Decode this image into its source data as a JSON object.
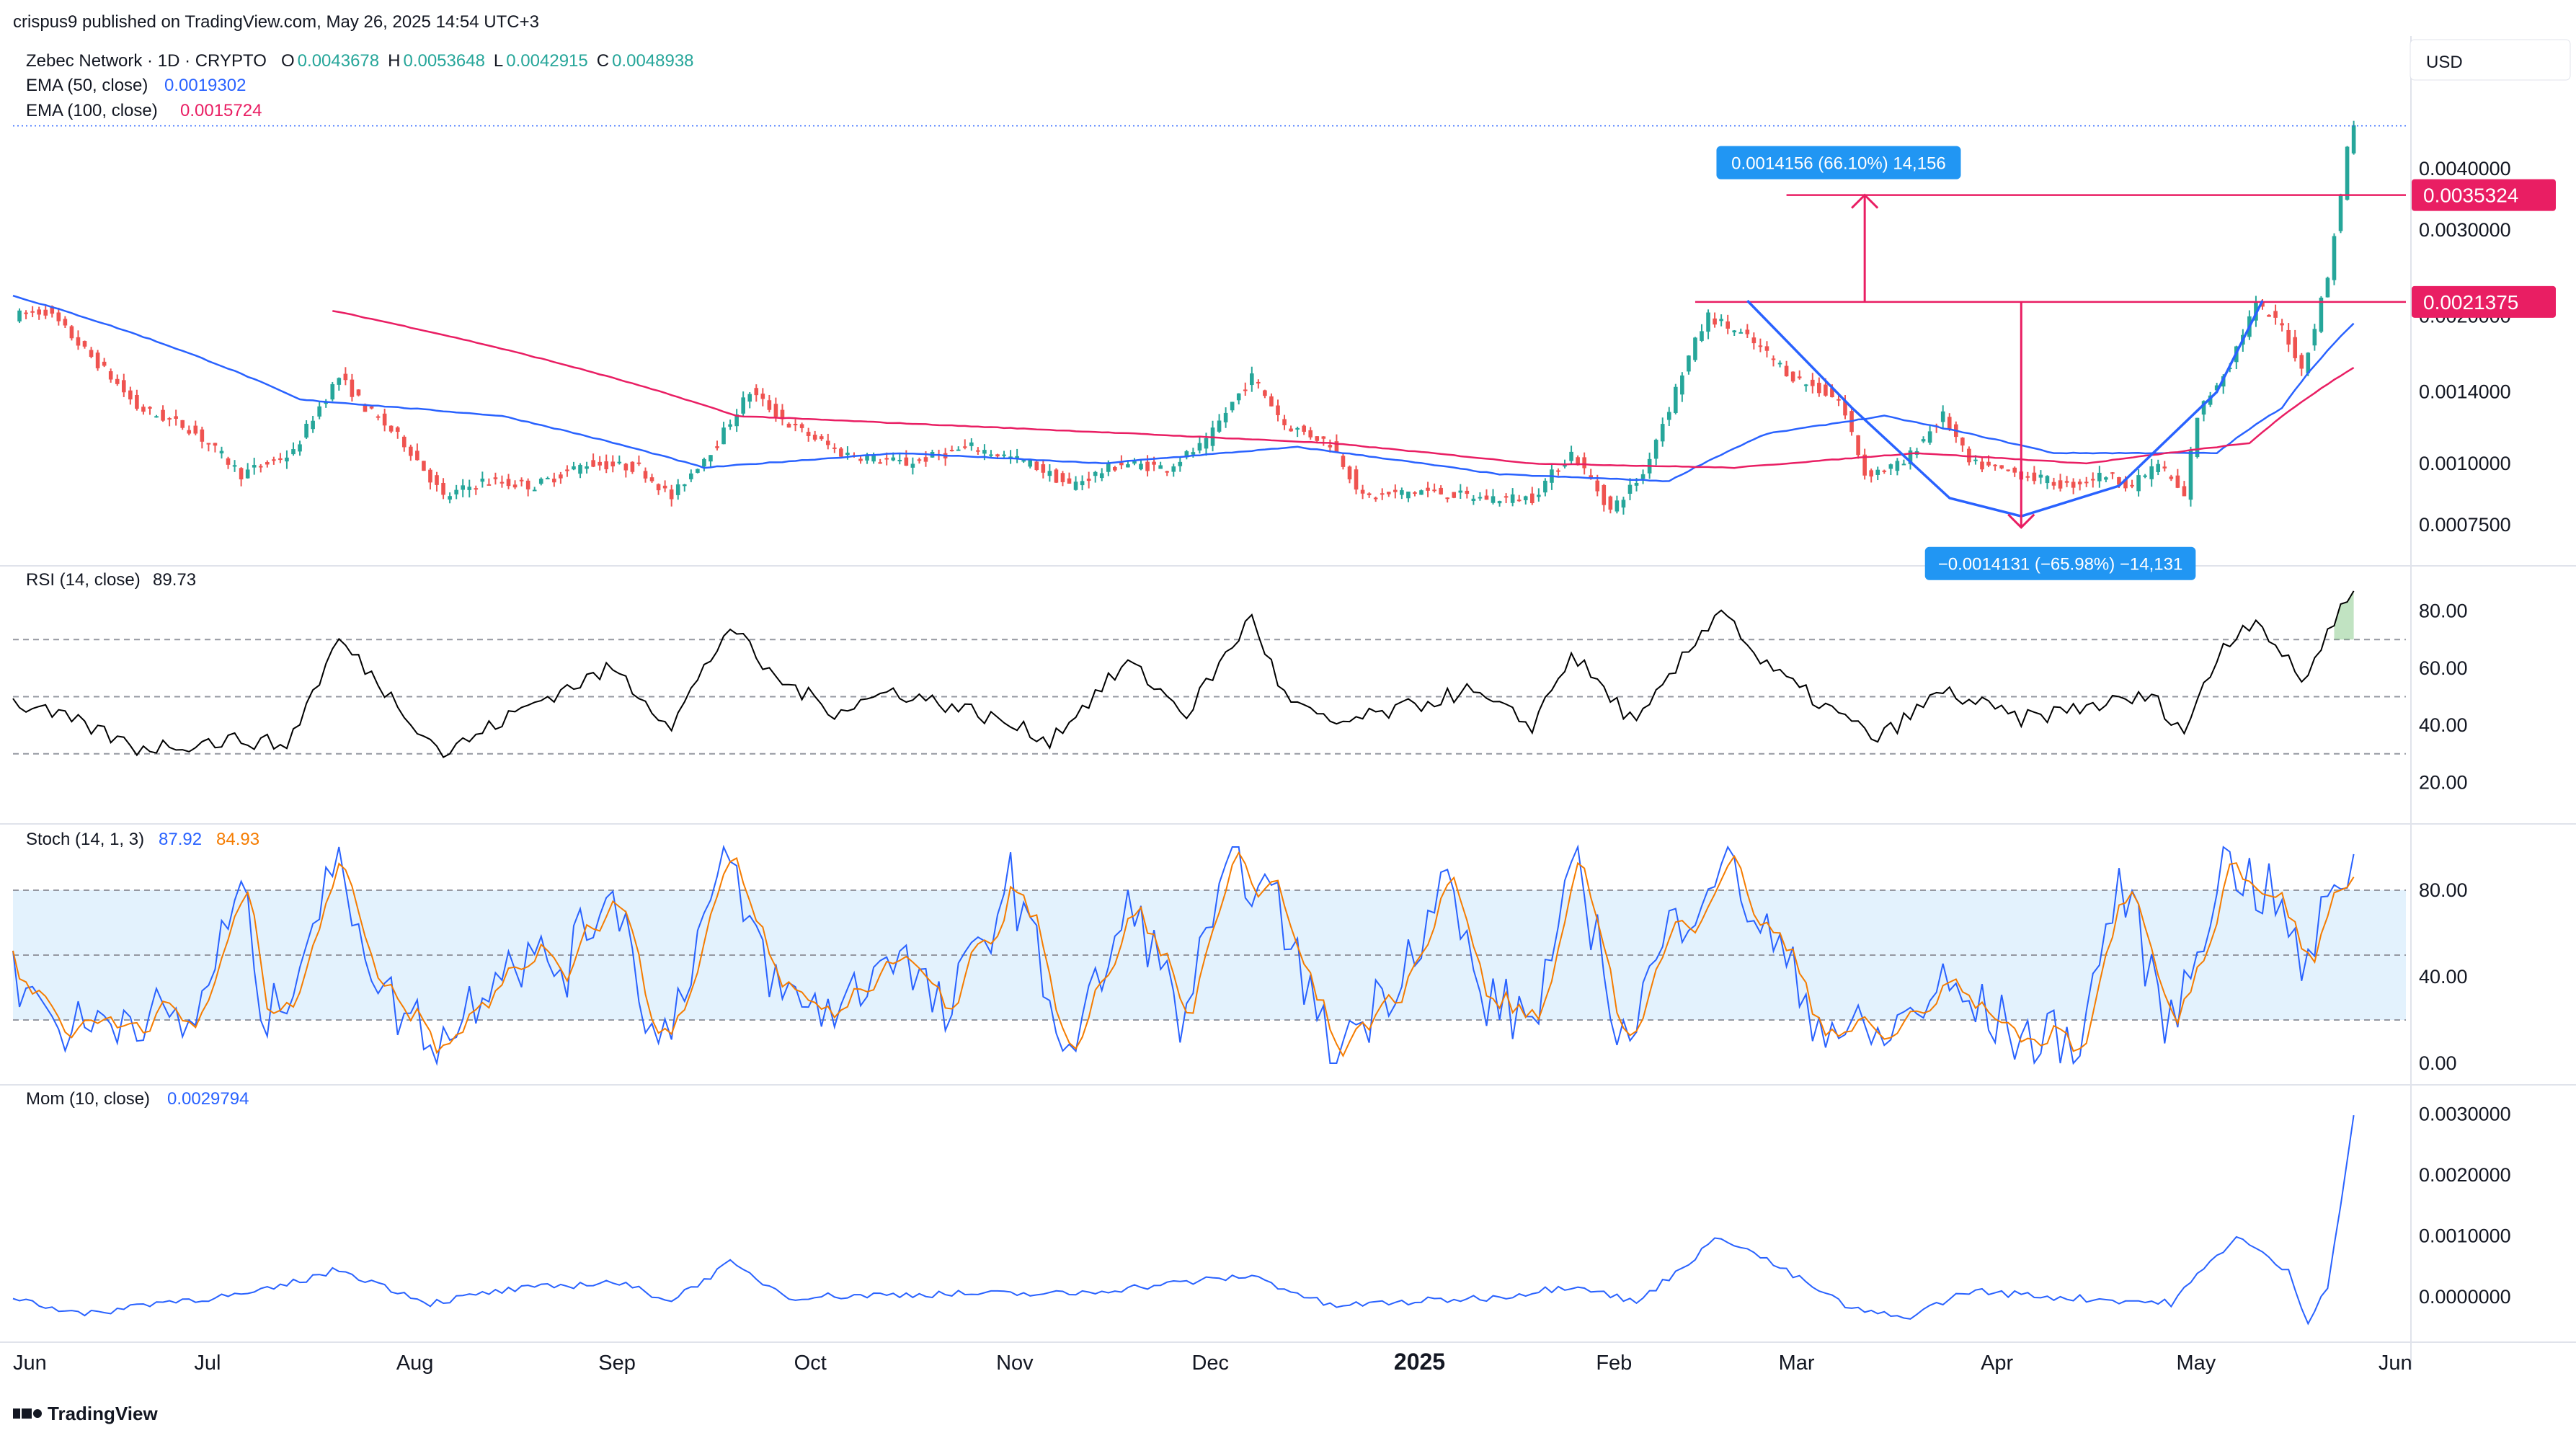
{
  "header": {
    "published": "crispus9 published on TradingView.com, May 26, 2025 14:54 UTC+3",
    "currency": "USD",
    "branding": "TradingView"
  },
  "symbol": {
    "name": "Zebec Network · 1D · CRYPTO",
    "ohlc": [
      {
        "label": "O",
        "value": "0.0043678"
      },
      {
        "label": "H",
        "value": "0.0053648"
      },
      {
        "label": "L",
        "value": "0.0042915"
      },
      {
        "label": "C",
        "value": "0.0048938"
      }
    ],
    "ema50": {
      "label": "EMA (50, close)",
      "value": "0.0019302"
    },
    "ema100": {
      "label": "EMA (100, close)",
      "value": "0.0015724"
    }
  },
  "price_axis": {
    "ticks": [
      "0.0040000",
      "0.0030000",
      "0.0014000",
      "0.0010000",
      "0.0007500"
    ],
    "tick_values": [
      0.004,
      0.003,
      0.0014,
      0.001,
      0.00075
    ],
    "marker_tick": "0.0020000",
    "marker_tick_value": 0.002,
    "levels": [
      {
        "label": "0.0035324",
        "value": 0.0035324
      },
      {
        "label": "0.0021375",
        "value": 0.0021375
      }
    ]
  },
  "measurements": [
    {
      "label": "0.0014156 (66.10%) 14,156",
      "color": "#2196f3"
    },
    {
      "label": "−0.0014131 (−65.98%) −14,131",
      "color": "#2196f3"
    }
  ],
  "rsi": {
    "label": "RSI (14, close)",
    "value": "89.73",
    "ticks": [
      "80.00",
      "60.00",
      "40.00",
      "20.00"
    ],
    "tick_values": [
      80,
      60,
      40,
      20
    ],
    "band_levels": [
      70,
      50,
      30
    ]
  },
  "stoch": {
    "label": "Stoch (14, 1, 3)",
    "k_value": "87.92",
    "d_value": "84.93",
    "ticks": [
      "80.00",
      "40.00",
      "0.00"
    ],
    "tick_values": [
      80,
      40,
      0
    ],
    "band_levels": [
      80,
      50,
      20
    ]
  },
  "mom": {
    "label": "Mom (10, close)",
    "value": "0.0029794",
    "ticks": [
      "0.0030000",
      "0.0020000",
      "0.0010000",
      "0.0000000"
    ],
    "tick_values": [
      0.003,
      0.002,
      0.001,
      0
    ]
  },
  "time_axis": {
    "labels": [
      "Jun",
      "Jul",
      "Aug",
      "Sep",
      "Oct",
      "Nov",
      "Dec",
      "2025",
      "Feb",
      "Mar",
      "Apr",
      "May",
      "Jun"
    ],
    "bold_label": "2025"
  },
  "colors": {
    "up": "#26a69a",
    "down": "#ef5350",
    "ema50": "#2962ff",
    "ema100": "#e91e63",
    "level": "#e91e63",
    "rsi": "#000000",
    "stoch_k": "#2962ff",
    "stoch_d": "#f57c00",
    "mom": "#2962ff",
    "band_fill": "#e3f2fd",
    "measure": "#2196f3"
  },
  "chart_data": {
    "type": "candlestick",
    "title": "Zebec Network · 1D · CRYPTO",
    "x_range": [
      "2024-06-01",
      "2025-06-03"
    ],
    "y_range": [
      0.00065,
      0.0055
    ],
    "y_scale": "log",
    "anchors": [
      [
        "2024-06-01",
        0.002
      ],
      [
        "2024-06-06",
        0.00205
      ],
      [
        "2024-06-12",
        0.0017
      ],
      [
        "2024-06-20",
        0.0013
      ],
      [
        "2024-06-28",
        0.00118
      ],
      [
        "2024-07-06",
        0.00095
      ],
      [
        "2024-07-14",
        0.00105
      ],
      [
        "2024-07-21",
        0.0015
      ],
      [
        "2024-07-25",
        0.0013
      ],
      [
        "2024-07-31",
        0.0011
      ],
      [
        "2024-08-06",
        0.00085
      ],
      [
        "2024-08-12",
        0.00092
      ],
      [
        "2024-08-20",
        0.0009
      ],
      [
        "2024-08-28",
        0.001
      ],
      [
        "2024-09-05",
        0.00098
      ],
      [
        "2024-09-10",
        0.00085
      ],
      [
        "2024-09-17",
        0.0011
      ],
      [
        "2024-09-22",
        0.0014
      ],
      [
        "2024-09-28",
        0.0012
      ],
      [
        "2024-10-06",
        0.00105
      ],
      [
        "2024-10-16",
        0.001
      ],
      [
        "2024-10-26",
        0.00108
      ],
      [
        "2024-11-04",
        0.001
      ],
      [
        "2024-11-10",
        0.0009
      ],
      [
        "2024-11-18",
        0.001
      ],
      [
        "2024-11-25",
        0.00098
      ],
      [
        "2024-12-01",
        0.0011
      ],
      [
        "2024-12-08",
        0.0015
      ],
      [
        "2024-12-13",
        0.0012
      ],
      [
        "2024-12-20",
        0.0011
      ],
      [
        "2024-12-25",
        0.00085
      ],
      [
        "2025-01-03",
        0.00088
      ],
      [
        "2025-01-12",
        0.00085
      ],
      [
        "2025-01-20",
        0.00085
      ],
      [
        "2025-01-26",
        0.00105
      ],
      [
        "2025-02-01",
        0.0008
      ],
      [
        "2025-02-06",
        0.00095
      ],
      [
        "2025-02-10",
        0.0013
      ],
      [
        "2025-02-16",
        0.002
      ],
      [
        "2025-02-22",
        0.0018
      ],
      [
        "2025-03-01",
        0.0015
      ],
      [
        "2025-03-08",
        0.00135
      ],
      [
        "2025-03-12",
        0.00095
      ],
      [
        "2025-03-18",
        0.001
      ],
      [
        "2025-03-24",
        0.00125
      ],
      [
        "2025-03-28",
        0.001
      ],
      [
        "2025-04-05",
        0.00095
      ],
      [
        "2025-04-12",
        0.0009
      ],
      [
        "2025-04-18",
        0.00095
      ],
      [
        "2025-04-22",
        0.0009
      ],
      [
        "2025-04-26",
        0.001
      ],
      [
        "2025-04-30",
        0.00085
      ],
      [
        "2025-05-02",
        0.00125
      ],
      [
        "2025-05-07",
        0.0016
      ],
      [
        "2025-05-11",
        0.0021
      ],
      [
        "2025-05-15",
        0.0019
      ],
      [
        "2025-05-18",
        0.00155
      ],
      [
        "2025-05-20",
        0.0019
      ],
      [
        "2025-05-22",
        0.0024
      ],
      [
        "2025-05-24",
        0.0035
      ],
      [
        "2025-05-25",
        0.0044
      ],
      [
        "2025-05-26",
        0.00489
      ]
    ],
    "ema50_path": [
      [
        "2024-06-01",
        0.0022
      ],
      [
        "2024-07-15",
        0.00135
      ],
      [
        "2024-08-15",
        0.00125
      ],
      [
        "2024-09-15",
        0.00098
      ],
      [
        "2024-10-15",
        0.00105
      ],
      [
        "2024-11-15",
        0.001
      ],
      [
        "2024-12-15",
        0.00108
      ],
      [
        "2025-01-15",
        0.00095
      ],
      [
        "2025-02-10",
        0.00092
      ],
      [
        "2025-02-25",
        0.00115
      ],
      [
        "2025-03-15",
        0.00125
      ],
      [
        "2025-04-10",
        0.00105
      ],
      [
        "2025-05-05",
        0.00105
      ],
      [
        "2025-05-15",
        0.0013
      ],
      [
        "2025-05-26",
        0.00193
      ]
    ],
    "ema100_path": [
      [
        "2024-07-20",
        0.00205
      ],
      [
        "2024-08-20",
        0.00165
      ],
      [
        "2024-09-20",
        0.00125
      ],
      [
        "2024-10-20",
        0.0012
      ],
      [
        "2024-11-20",
        0.00115
      ],
      [
        "2024-12-20",
        0.0011
      ],
      [
        "2025-01-20",
        0.001
      ],
      [
        "2025-02-20",
        0.00098
      ],
      [
        "2025-03-20",
        0.00105
      ],
      [
        "2025-04-15",
        0.001
      ],
      [
        "2025-05-10",
        0.0011
      ],
      [
        "2025-05-26",
        0.00157
      ]
    ],
    "cup_path": [
      [
        "2025-02-22",
        0.00215
      ],
      [
        "2025-03-10",
        0.0013
      ],
      [
        "2025-03-25",
        0.00085
      ],
      [
        "2025-04-05",
        0.00078
      ],
      [
        "2025-04-20",
        0.0009
      ],
      [
        "2025-05-05",
        0.0014
      ],
      [
        "2025-05-12",
        0.00215
      ]
    ],
    "measure_up": {
      "date": "2025-03-12",
      "from": 0.0021375,
      "to": 0.0035324
    },
    "measure_down": {
      "date": "2025-04-05",
      "from": 0.0021375,
      "to": 0.00074
    },
    "level_spans": [
      {
        "value": 0.0035324,
        "start": "2025-02-28",
        "end": "2025-06-03"
      },
      {
        "value": 0.0021375,
        "start": "2025-02-14",
        "end": "2025-06-03"
      }
    ],
    "rsi_anchors": [
      [
        "2024-06-01",
        48
      ],
      [
        "2024-06-12",
        40
      ],
      [
        "2024-06-20",
        32
      ],
      [
        "2024-07-06",
        35
      ],
      [
        "2024-07-13",
        33
      ],
      [
        "2024-07-21",
        70
      ],
      [
        "2024-07-31",
        45
      ],
      [
        "2024-08-06",
        30
      ],
      [
        "2024-08-20",
        48
      ],
      [
        "2024-09-01",
        60
      ],
      [
        "2024-09-10",
        40
      ],
      [
        "2024-09-19",
        75
      ],
      [
        "2024-09-25",
        58
      ],
      [
        "2024-10-05",
        45
      ],
      [
        "2024-10-14",
        52
      ],
      [
        "2024-10-26",
        45
      ],
      [
        "2024-11-07",
        35
      ],
      [
        "2024-11-19",
        62
      ],
      [
        "2024-11-28",
        44
      ],
      [
        "2024-12-08",
        78
      ],
      [
        "2024-12-13",
        50
      ],
      [
        "2024-12-20",
        40
      ],
      [
        "2024-12-30",
        45
      ],
      [
        "2025-01-10",
        52
      ],
      [
        "2025-01-20",
        40
      ],
      [
        "2025-01-26",
        65
      ],
      [
        "2025-02-05",
        40
      ],
      [
        "2025-02-18",
        82
      ],
      [
        "2025-02-24",
        62
      ],
      [
        "2025-03-05",
        48
      ],
      [
        "2025-03-14",
        35
      ],
      [
        "2025-03-24",
        52
      ],
      [
        "2025-04-05",
        42
      ],
      [
        "2025-04-16",
        47
      ],
      [
        "2025-04-25",
        50
      ],
      [
        "2025-04-30",
        38
      ],
      [
        "2025-05-06",
        68
      ],
      [
        "2025-05-11",
        78
      ],
      [
        "2025-05-18",
        55
      ],
      [
        "2025-05-22",
        72
      ],
      [
        "2025-05-26",
        89.73
      ]
    ],
    "stoch_anchors": [
      [
        "2024-06-01",
        40
      ],
      [
        "2024-06-10",
        15
      ],
      [
        "2024-06-20",
        25
      ],
      [
        "2024-06-28",
        15
      ],
      [
        "2024-07-06",
        80
      ],
      [
        "2024-07-10",
        15
      ],
      [
        "2024-07-21",
        95
      ],
      [
        "2024-07-28",
        30
      ],
      [
        "2024-08-06",
        10
      ],
      [
        "2024-08-15",
        50
      ],
      [
        "2024-08-25",
        45
      ],
      [
        "2024-09-01",
        85
      ],
      [
        "2024-09-08",
        5
      ],
      [
        "2024-09-18",
        92
      ],
      [
        "2024-09-27",
        30
      ],
      [
        "2024-10-06",
        25
      ],
      [
        "2024-10-14",
        55
      ],
      [
        "2024-10-22",
        20
      ],
      [
        "2024-11-01",
        85
      ],
      [
        "2024-11-10",
        5
      ],
      [
        "2024-11-20",
        75
      ],
      [
        "2024-11-27",
        20
      ],
      [
        "2024-12-06",
        95
      ],
      [
        "2024-12-13",
        65
      ],
      [
        "2024-12-20",
        5
      ],
      [
        "2024-12-28",
        30
      ],
      [
        "2025-01-07",
        85
      ],
      [
        "2025-01-12",
        30
      ],
      [
        "2025-01-20",
        20
      ],
      [
        "2025-01-27",
        90
      ],
      [
        "2025-02-03",
        10
      ],
      [
        "2025-02-10",
        60
      ],
      [
        "2025-02-18",
        95
      ],
      [
        "2025-02-25",
        60
      ],
      [
        "2025-03-05",
        20
      ],
      [
        "2025-03-14",
        10
      ],
      [
        "2025-03-24",
        35
      ],
      [
        "2025-04-05",
        12
      ],
      [
        "2025-04-14",
        10
      ],
      [
        "2025-04-20",
        85
      ],
      [
        "2025-04-28",
        15
      ],
      [
        "2025-05-06",
        95
      ],
      [
        "2025-05-14",
        75
      ],
      [
        "2025-05-19",
        40
      ],
      [
        "2025-05-23",
        90
      ],
      [
        "2025-05-26",
        87.92
      ]
    ],
    "mom_anchors": [
      [
        "2024-06-01",
        0.0
      ],
      [
        "2024-06-12",
        -0.0003
      ],
      [
        "2024-06-22",
        -0.0001
      ],
      [
        "2024-07-08",
        5e-05
      ],
      [
        "2024-07-21",
        0.00045
      ],
      [
        "2024-08-04",
        -0.0001
      ],
      [
        "2024-08-15",
        0.0001
      ],
      [
        "2024-09-01",
        0.00025
      ],
      [
        "2024-09-10",
        -5e-05
      ],
      [
        "2024-09-19",
        0.00055
      ],
      [
        "2024-09-28",
        0.0
      ],
      [
        "2024-10-20",
        5e-05
      ],
      [
        "2024-11-10",
        5e-05
      ],
      [
        "2024-12-08",
        0.00035
      ],
      [
        "2024-12-20",
        -0.00015
      ],
      [
        "2025-01-15",
        0.0
      ],
      [
        "2025-01-27",
        0.0002
      ],
      [
        "2025-02-05",
        -0.0001
      ],
      [
        "2025-02-18",
        0.001
      ],
      [
        "2025-02-25",
        0.0006
      ],
      [
        "2025-03-10",
        -0.0002
      ],
      [
        "2025-03-18",
        -0.00035
      ],
      [
        "2025-03-28",
        0.0001
      ],
      [
        "2025-04-10",
        0.0
      ],
      [
        "2025-04-28",
        -0.0001
      ],
      [
        "2025-05-08",
        0.001
      ],
      [
        "2025-05-16",
        0.0004
      ],
      [
        "2025-05-19",
        -0.0004
      ],
      [
        "2025-05-22",
        0.0002
      ],
      [
        "2025-05-24",
        0.0015
      ],
      [
        "2025-05-26",
        0.0029794
      ]
    ]
  }
}
